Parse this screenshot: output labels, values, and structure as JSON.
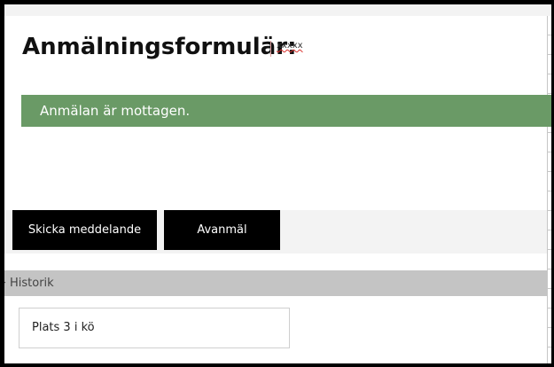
{
  "header": {
    "title": "Anmälningsformulär:",
    "value": "xxxxx"
  },
  "alert": {
    "message": "Anmälan är mottagen.",
    "color": "#6a9a66"
  },
  "actions": {
    "send_message_label": "Skicka meddelande",
    "unregister_label": "Avanmäl"
  },
  "history": {
    "label": "Historik",
    "expand_icon": "triangle-right-icon",
    "entry": "Plats 3 i kö"
  }
}
